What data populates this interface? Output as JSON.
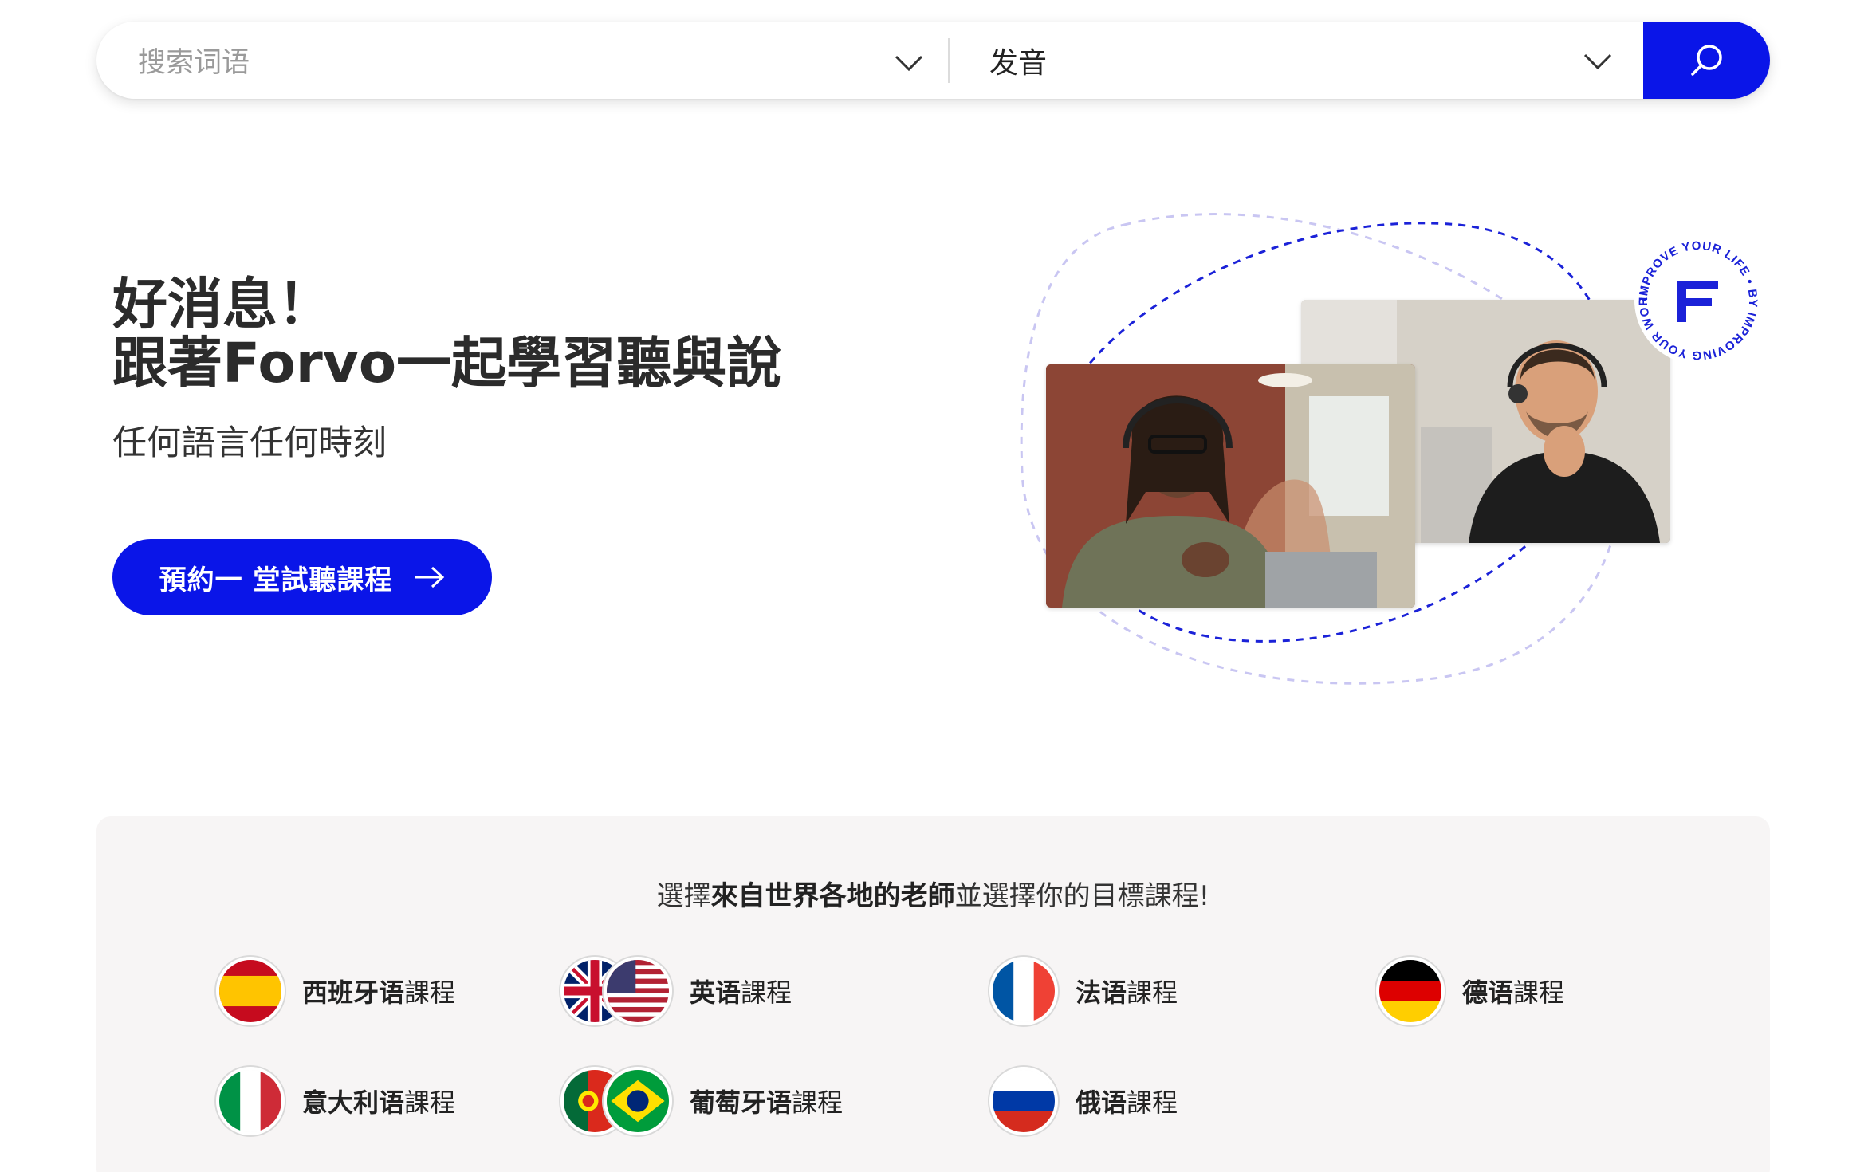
{
  "search": {
    "placeholder": "搜索词语",
    "mode": "发音",
    "button_icon": "search-icon"
  },
  "hero": {
    "title_line1": "好消息！",
    "title_line2": "跟著Forvo一起學習聽與說",
    "subtitle": "任何語言任何時刻",
    "cta_label": "預約一 堂試聽課程"
  },
  "badge": {
    "ring_text": "IMPROVE YOUR LIFE • BY IMPROVING YOUR WORDS •",
    "logo_letter": "F"
  },
  "courses": {
    "heading_pre": "選擇",
    "heading_bold": "來自世界各地的老師",
    "heading_post": "並選擇你的目標課程!",
    "items": [
      {
        "lang": "西班牙语",
        "suffix": "課程",
        "flags": [
          "es"
        ]
      },
      {
        "lang": "英语",
        "suffix": "課程",
        "flags": [
          "gb",
          "us"
        ]
      },
      {
        "lang": "法语",
        "suffix": "課程",
        "flags": [
          "fr"
        ]
      },
      {
        "lang": "德语",
        "suffix": "課程",
        "flags": [
          "de"
        ]
      },
      {
        "lang": "意大利语",
        "suffix": "課程",
        "flags": [
          "it"
        ]
      },
      {
        "lang": "葡萄牙语",
        "suffix": "課程",
        "flags": [
          "pt",
          "br"
        ]
      },
      {
        "lang": "俄语",
        "suffix": "課程",
        "flags": [
          "ru"
        ]
      }
    ]
  },
  "colors": {
    "accent": "#0a15e8",
    "panel_bg": "#f7f5f5"
  }
}
